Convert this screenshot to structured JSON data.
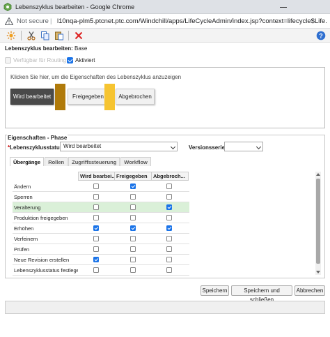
{
  "window": {
    "title": "Lebenszyklus bearbeiten - Google Chrome"
  },
  "address": {
    "security": "Not secure",
    "url": "l10nqa-plm5.ptcnet.ptc.com/Windchill/apps/LifeCycleAdmin/index.jsp?context=lifecycle$Life..."
  },
  "toolbar": {
    "icons": [
      "sun-icon",
      "cut-icon",
      "copy-icon",
      "paste-icon",
      "delete-icon",
      "help-icon"
    ]
  },
  "header": {
    "label": "Lebenszyklus bearbeiten:",
    "value": "Base"
  },
  "options": {
    "routing_label": "Verfügbar für Routing",
    "routing_checked": false,
    "active_label": "Aktiviert",
    "active_checked": true
  },
  "lifecycle": {
    "hint": "Klicken Sie hier, um die Eigenschaften des Lebenszyklus anzuzeigen",
    "phases": [
      "Wird bearbeitet",
      "Freigegeben",
      "Abgebrochen"
    ],
    "connector_colors": [
      "#b07a0a",
      "#f6c431"
    ]
  },
  "phase_props": {
    "legend": "Eigenschaften - Phase",
    "status_required": "*",
    "status_label": "Lebenszyklusstatus:",
    "status_value": "Wird bearbeitet",
    "version_label": "Versionsserie:",
    "version_value": ""
  },
  "tabs": [
    "Übergänge",
    "Rollen",
    "Zugriffssteuerung",
    "Workflow"
  ],
  "grid": {
    "columns": [
      "Wird bearbei...",
      "Freigegeben",
      "Abgebroch..."
    ],
    "rows": [
      {
        "label": "Ändern",
        "values": [
          false,
          true,
          false
        ],
        "highlight": false
      },
      {
        "label": "Sperren",
        "values": [
          false,
          false,
          false
        ],
        "highlight": false
      },
      {
        "label": "Veralterung",
        "values": [
          false,
          false,
          true
        ],
        "highlight": true
      },
      {
        "label": "Produktion freigegeben",
        "values": [
          false,
          false,
          false
        ],
        "highlight": false
      },
      {
        "label": "Erhöhen",
        "values": [
          true,
          true,
          true
        ],
        "highlight": false
      },
      {
        "label": "Verfeinern",
        "values": [
          false,
          false,
          false
        ],
        "highlight": false
      },
      {
        "label": "Prüfen",
        "values": [
          false,
          false,
          false
        ],
        "highlight": false
      },
      {
        "label": "Neue Revision erstellen",
        "values": [
          true,
          false,
          false
        ],
        "highlight": false
      },
      {
        "label": "Lebenszyklusstatus festlegen",
        "values": [
          false,
          false,
          false
        ],
        "highlight": false
      }
    ]
  },
  "buttons": {
    "save": "Speichern",
    "save_close": "Speichern und schließen",
    "cancel": "Abbrechen"
  },
  "colors": {
    "accent": "#1a73e8",
    "highlight_row": "#daf0d8",
    "active_phase": "#4a4a4a"
  }
}
